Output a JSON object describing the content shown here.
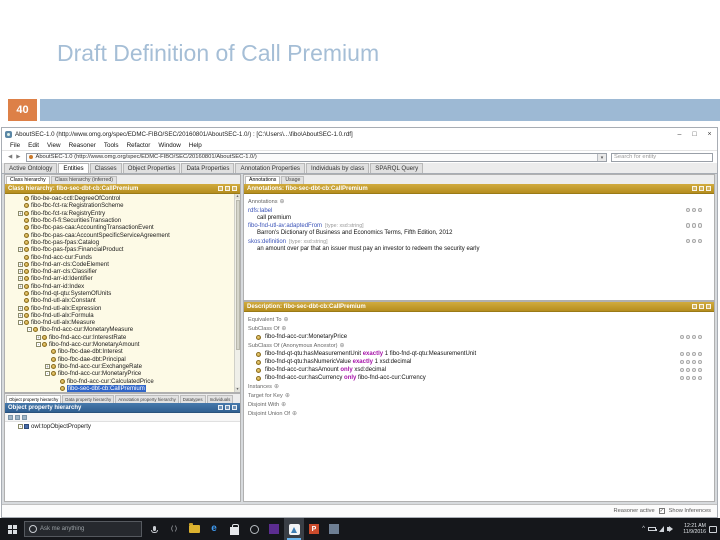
{
  "slide": {
    "title": "Draft Definition of Call Premium",
    "number": "40"
  },
  "colors": {
    "accent_orange": "#dd8047",
    "accent_blue": "#9db9d4",
    "panel_header_gold": "#c49a2e",
    "selection_blue": "#3166c8",
    "keyword_purple": "#a512a8"
  },
  "window": {
    "title": "AboutSEC-1.0 (http://www.omg.org/spec/EDMC-FIBO/SEC/20160801/AboutSEC-1.0/) : [C:\\Users\\...\\fibo\\AboutSEC-1.0.rdf]",
    "controls": {
      "minimize": "–",
      "maximize": "□",
      "close": "×"
    },
    "menu": [
      "File",
      "Edit",
      "View",
      "Reasoner",
      "Tools",
      "Refactor",
      "Window",
      "Help"
    ],
    "address": "AboutSEC-1.0 (http://www.omg.org/spec/EDMC-FIBO/SEC/20160801/AboutSEC-1.0/)",
    "search_placeholder": "Search for entity",
    "tabs": [
      {
        "label": "Active Ontology"
      },
      {
        "label": "Entities",
        "active": true
      },
      {
        "label": "Classes"
      },
      {
        "label": "Object Properties"
      },
      {
        "label": "Data Properties"
      },
      {
        "label": "Annotation Properties"
      },
      {
        "label": "Individuals by class"
      },
      {
        "label": "SPARQL Query"
      }
    ]
  },
  "class_panel": {
    "tabs": [
      {
        "label": "Class hierarchy",
        "active": true
      },
      {
        "label": "Class hierarchy (inferred)"
      }
    ],
    "header": "Class hierarchy: fibo-sec-dbt-cb:CallPremium",
    "tree": [
      {
        "lvl": 1,
        "label": "fibo-be-oac-cctl:DegreeOfControl"
      },
      {
        "lvl": 1,
        "label": "fibo-fbc-fct-ra:RegistrationScheme"
      },
      {
        "lvl": 1,
        "label": "fibo-fbc-fct-ra:RegistryEntry",
        "exp": "+"
      },
      {
        "lvl": 1,
        "label": "fibo-fbc-fi-fi:SecuritiesTransaction"
      },
      {
        "lvl": 1,
        "label": "fibo-fbc-pas-caa:AccountingTransactionEvent"
      },
      {
        "lvl": 1,
        "label": "fibo-fbc-pas-caa:AccountSpecificServiceAgreement"
      },
      {
        "lvl": 1,
        "label": "fibo-fbc-pas-fpas:Catalog"
      },
      {
        "lvl": 1,
        "label": "fibo-fbc-pas-fpas:FinancialProduct",
        "exp": "+"
      },
      {
        "lvl": 1,
        "label": "fibo-fnd-acc-cur:Funds"
      },
      {
        "lvl": 1,
        "label": "fibo-fnd-arr-cls:CodeElement",
        "exp": "+"
      },
      {
        "lvl": 1,
        "label": "fibo-fnd-arr-cls:Classifier",
        "exp": "+"
      },
      {
        "lvl": 1,
        "label": "fibo-fnd-arr-id:Identifier",
        "exp": "+"
      },
      {
        "lvl": 1,
        "label": "fibo-fnd-arr-id:Index",
        "exp": "+"
      },
      {
        "lvl": 1,
        "label": "fibo-fnd-qt-qtu:SystemOfUnits"
      },
      {
        "lvl": 1,
        "label": "fibo-fnd-utl-alx:Constant"
      },
      {
        "lvl": 1,
        "label": "fibo-fnd-utl-alx:Expression",
        "exp": "+"
      },
      {
        "lvl": 1,
        "label": "fibo-fnd-utl-alx:Formula",
        "exp": "+"
      },
      {
        "lvl": 1,
        "label": "fibo-fnd-utl-alx:Measure",
        "exp": "-"
      },
      {
        "lvl": 2,
        "label": "fibo-fnd-acc-cur:MonetaryMeasure",
        "exp": "-"
      },
      {
        "lvl": 3,
        "label": "fibo-fnd-acc-cur:InterestRate",
        "exp": "+"
      },
      {
        "lvl": 3,
        "label": "fibo-fnd-acc-cur:MonetaryAmount",
        "exp": "-"
      },
      {
        "lvl": 4,
        "label": "fibo-fbc-dae-dbt:Interest"
      },
      {
        "lvl": 4,
        "label": "fibo-fbc-dae-dbt:Principal"
      },
      {
        "lvl": 4,
        "label": "fibo-fnd-acc-cur:ExchangeRate",
        "exp": "+"
      },
      {
        "lvl": 4,
        "label": "fibo-fnd-acc-cur:MonetaryPrice",
        "exp": "-"
      },
      {
        "lvl": 5,
        "label": "fibo-fnd-acc-cur:CalculatedPrice"
      },
      {
        "lvl": 5,
        "label": "fibo-sec-dbt-cb:CallPremium",
        "selected": true
      }
    ]
  },
  "objprop_panel": {
    "tabs": [
      {
        "label": "Object property hierarchy",
        "active": true
      },
      {
        "label": "Data property hierarchy"
      },
      {
        "label": "Annotation property hierarchy"
      },
      {
        "label": "Datatypes"
      },
      {
        "label": "Individuals"
      }
    ],
    "header": "Object property hierarchy",
    "tree": [
      {
        "lvl": 1,
        "label": "owl:topObjectProperty",
        "exp": "-"
      }
    ]
  },
  "annotations_panel": {
    "tabs": [
      {
        "label": "Annotations",
        "active": true
      },
      {
        "label": "Usage"
      }
    ],
    "header": "Annotations: fibo-sec-dbt-cb:CallPremium",
    "section_label": "Annotations",
    "rows": [
      {
        "property": "rdfs:label",
        "type": "",
        "value": "call premium"
      },
      {
        "property": "fibo-fnd-utl-av:adaptedFrom",
        "type": "[type: xsd:string]",
        "value": "Barron's Dictionary of Business and Economics Terms, Fifth Edition, 2012"
      },
      {
        "property": "skos:definition",
        "type": "[type: xsd:string]",
        "value": "an amount over par that an issuer must pay an investor to redeem the security early"
      }
    ]
  },
  "description_panel": {
    "header": "Description: fibo-sec-dbt-cb:CallPremium",
    "sections": [
      {
        "label": "Equivalent To",
        "rows": []
      },
      {
        "label": "SubClass Of",
        "rows": [
          {
            "segments": [
              {
                "t": "fibo-fnd-acc-cur:MonetaryPrice"
              }
            ]
          }
        ]
      },
      {
        "label": "SubClass Of (Anonymous Ancestor)",
        "rows": [
          {
            "segments": [
              {
                "t": "fibo-fnd-qt-qtu:hasMeasurementUnit "
              },
              {
                "t": "exactly",
                "k": 1
              },
              {
                "t": " 1 fibo-fnd-qt-qtu:MeasurementUnit"
              }
            ]
          },
          {
            "segments": [
              {
                "t": "fibo-fnd-qt-qtu:hasNumericValue "
              },
              {
                "t": "exactly",
                "k": 1
              },
              {
                "t": " 1 xsd:decimal"
              }
            ]
          },
          {
            "segments": [
              {
                "t": "fibo-fnd-acc-cur:hasAmount "
              },
              {
                "t": "only",
                "k": 1
              },
              {
                "t": " xsd:decimal"
              }
            ]
          },
          {
            "segments": [
              {
                "t": "fibo-fnd-acc-cur:hasCurrency "
              },
              {
                "t": "only",
                "k": 1
              },
              {
                "t": " fibo-fnd-acc-cur:Currency"
              }
            ]
          }
        ]
      },
      {
        "label": "Instances",
        "rows": []
      },
      {
        "label": "Target for Key",
        "rows": []
      },
      {
        "label": "Disjoint With",
        "rows": []
      },
      {
        "label": "Disjoint Union Of",
        "rows": []
      }
    ]
  },
  "statusbar": {
    "reasoner": "Reasoner active",
    "show_inferences": "Show Inferences"
  },
  "taskbar": {
    "search_placeholder": "Ask me anything",
    "glyphs": {
      "brackets": "( )",
      "edge": "e",
      "powerpoint": "P"
    },
    "clock": {
      "time": "12:21 AM",
      "date": "11/9/2016"
    }
  },
  "icons": {
    "plus-circle": "⊕",
    "checkbox-check": "✓",
    "back": "◀",
    "forward": "▶",
    "dropdown": "▾",
    "chevron-up": "^",
    "scroll-up": "▲",
    "scroll-down": "▼"
  }
}
